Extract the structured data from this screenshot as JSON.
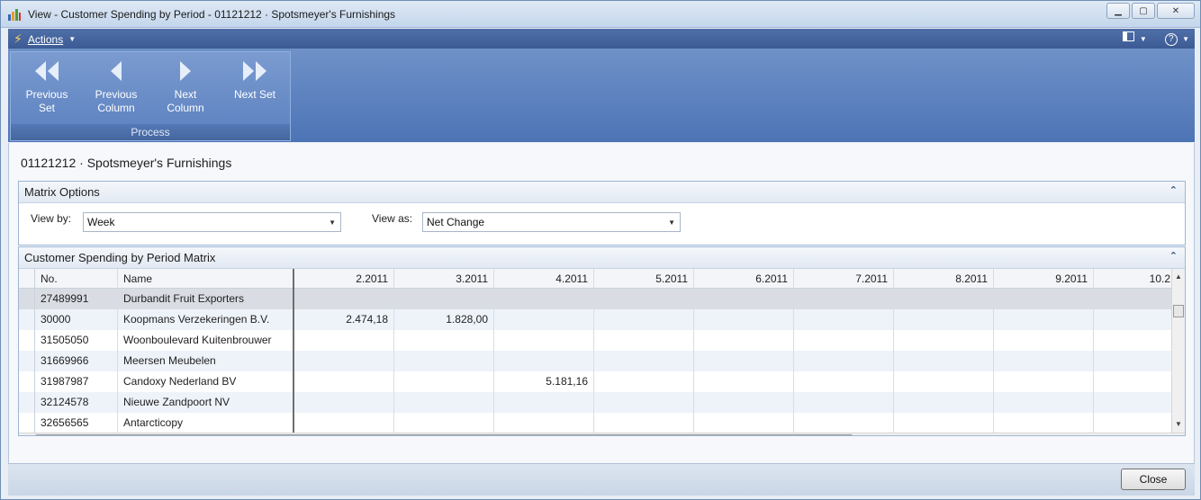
{
  "window": {
    "title": "View - Customer Spending by Period - 01121212 · Spotsmeyer's Furnishings",
    "controls": [
      "minimize",
      "maximize",
      "close"
    ]
  },
  "command_bar": {
    "actions_label": "Actions",
    "icons": [
      "lightning-icon",
      "layout-icon",
      "help-icon"
    ]
  },
  "ribbon": {
    "buttons": [
      {
        "line1": "Previous",
        "line2": "Set",
        "icon": "double-left-arrow-icon"
      },
      {
        "line1": "Previous",
        "line2": "Column",
        "icon": "left-arrow-icon"
      },
      {
        "line1": "Next",
        "line2": "Column",
        "icon": "right-arrow-icon"
      },
      {
        "line1": "Next Set",
        "line2": "",
        "icon": "double-right-arrow-icon"
      }
    ],
    "group_label": "Process"
  },
  "page": {
    "title": "01121212 · Spotsmeyer's Furnishings"
  },
  "matrix_options": {
    "header": "Matrix Options",
    "view_by_label": "View by:",
    "view_by_value": "Week",
    "view_as_label": "View as:",
    "view_as_value": "Net Change"
  },
  "matrix": {
    "header": "Customer Spending by Period Matrix",
    "columns": [
      "No.",
      "Name",
      "2.2011",
      "3.2011",
      "4.2011",
      "5.2011",
      "6.2011",
      "7.2011",
      "8.2011",
      "9.2011",
      "10.2"
    ],
    "rows": [
      {
        "no": "27489991",
        "name": "Durbandit Fruit Exporters",
        "values": [
          "",
          "",
          "",
          "",
          "",
          "",
          "",
          "",
          ""
        ]
      },
      {
        "no": "30000",
        "name": "Koopmans Verzekeringen B.V.",
        "values": [
          "2.474,18",
          "1.828,00",
          "",
          "",
          "",
          "",
          "",
          "",
          ""
        ]
      },
      {
        "no": "31505050",
        "name": "Woonboulevard Kuitenbrouwer",
        "values": [
          "",
          "",
          "",
          "",
          "",
          "",
          "",
          "",
          ""
        ]
      },
      {
        "no": "31669966",
        "name": "Meersen Meubelen",
        "values": [
          "",
          "",
          "",
          "",
          "",
          "",
          "",
          "",
          ""
        ]
      },
      {
        "no": "31987987",
        "name": "Candoxy Nederland BV",
        "values": [
          "",
          "",
          "5.181,16",
          "",
          "",
          "",
          "",
          "",
          ""
        ]
      },
      {
        "no": "32124578",
        "name": "Nieuwe Zandpoort NV",
        "values": [
          "",
          "",
          "",
          "",
          "",
          "",
          "",
          "",
          ""
        ]
      },
      {
        "no": "32656565",
        "name": "Antarcticopy",
        "values": [
          "",
          "",
          "",
          "",
          "",
          "",
          "",
          "",
          ""
        ]
      }
    ]
  },
  "footer": {
    "close_label": "Close"
  },
  "colors": {
    "ribbon": "#5a80bf",
    "command_bar": "#3c5b94",
    "fasttab_border": "#9db6d6"
  }
}
